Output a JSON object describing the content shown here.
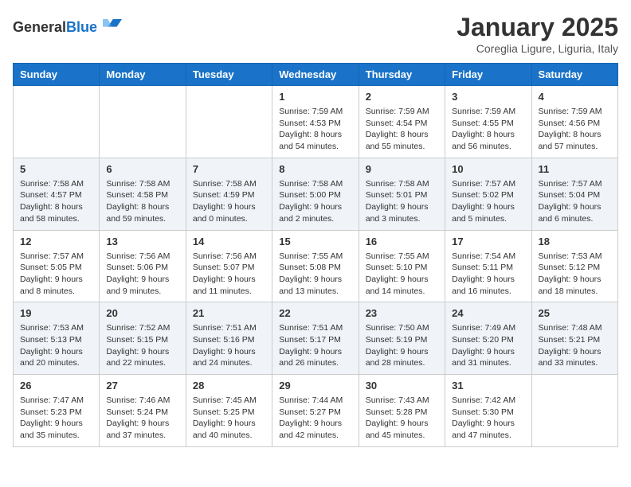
{
  "header": {
    "logo_general": "General",
    "logo_blue": "Blue",
    "month_title": "January 2025",
    "location": "Coreglia Ligure, Liguria, Italy"
  },
  "weekdays": [
    "Sunday",
    "Monday",
    "Tuesday",
    "Wednesday",
    "Thursday",
    "Friday",
    "Saturday"
  ],
  "weeks": [
    [
      {
        "day": "",
        "sunrise": "",
        "sunset": "",
        "daylight": ""
      },
      {
        "day": "",
        "sunrise": "",
        "sunset": "",
        "daylight": ""
      },
      {
        "day": "",
        "sunrise": "",
        "sunset": "",
        "daylight": ""
      },
      {
        "day": "1",
        "sunrise": "Sunrise: 7:59 AM",
        "sunset": "Sunset: 4:53 PM",
        "daylight": "Daylight: 8 hours and 54 minutes."
      },
      {
        "day": "2",
        "sunrise": "Sunrise: 7:59 AM",
        "sunset": "Sunset: 4:54 PM",
        "daylight": "Daylight: 8 hours and 55 minutes."
      },
      {
        "day": "3",
        "sunrise": "Sunrise: 7:59 AM",
        "sunset": "Sunset: 4:55 PM",
        "daylight": "Daylight: 8 hours and 56 minutes."
      },
      {
        "day": "4",
        "sunrise": "Sunrise: 7:59 AM",
        "sunset": "Sunset: 4:56 PM",
        "daylight": "Daylight: 8 hours and 57 minutes."
      }
    ],
    [
      {
        "day": "5",
        "sunrise": "Sunrise: 7:58 AM",
        "sunset": "Sunset: 4:57 PM",
        "daylight": "Daylight: 8 hours and 58 minutes."
      },
      {
        "day": "6",
        "sunrise": "Sunrise: 7:58 AM",
        "sunset": "Sunset: 4:58 PM",
        "daylight": "Daylight: 8 hours and 59 minutes."
      },
      {
        "day": "7",
        "sunrise": "Sunrise: 7:58 AM",
        "sunset": "Sunset: 4:59 PM",
        "daylight": "Daylight: 9 hours and 0 minutes."
      },
      {
        "day": "8",
        "sunrise": "Sunrise: 7:58 AM",
        "sunset": "Sunset: 5:00 PM",
        "daylight": "Daylight: 9 hours and 2 minutes."
      },
      {
        "day": "9",
        "sunrise": "Sunrise: 7:58 AM",
        "sunset": "Sunset: 5:01 PM",
        "daylight": "Daylight: 9 hours and 3 minutes."
      },
      {
        "day": "10",
        "sunrise": "Sunrise: 7:57 AM",
        "sunset": "Sunset: 5:02 PM",
        "daylight": "Daylight: 9 hours and 5 minutes."
      },
      {
        "day": "11",
        "sunrise": "Sunrise: 7:57 AM",
        "sunset": "Sunset: 5:04 PM",
        "daylight": "Daylight: 9 hours and 6 minutes."
      }
    ],
    [
      {
        "day": "12",
        "sunrise": "Sunrise: 7:57 AM",
        "sunset": "Sunset: 5:05 PM",
        "daylight": "Daylight: 9 hours and 8 minutes."
      },
      {
        "day": "13",
        "sunrise": "Sunrise: 7:56 AM",
        "sunset": "Sunset: 5:06 PM",
        "daylight": "Daylight: 9 hours and 9 minutes."
      },
      {
        "day": "14",
        "sunrise": "Sunrise: 7:56 AM",
        "sunset": "Sunset: 5:07 PM",
        "daylight": "Daylight: 9 hours and 11 minutes."
      },
      {
        "day": "15",
        "sunrise": "Sunrise: 7:55 AM",
        "sunset": "Sunset: 5:08 PM",
        "daylight": "Daylight: 9 hours and 13 minutes."
      },
      {
        "day": "16",
        "sunrise": "Sunrise: 7:55 AM",
        "sunset": "Sunset: 5:10 PM",
        "daylight": "Daylight: 9 hours and 14 minutes."
      },
      {
        "day": "17",
        "sunrise": "Sunrise: 7:54 AM",
        "sunset": "Sunset: 5:11 PM",
        "daylight": "Daylight: 9 hours and 16 minutes."
      },
      {
        "day": "18",
        "sunrise": "Sunrise: 7:53 AM",
        "sunset": "Sunset: 5:12 PM",
        "daylight": "Daylight: 9 hours and 18 minutes."
      }
    ],
    [
      {
        "day": "19",
        "sunrise": "Sunrise: 7:53 AM",
        "sunset": "Sunset: 5:13 PM",
        "daylight": "Daylight: 9 hours and 20 minutes."
      },
      {
        "day": "20",
        "sunrise": "Sunrise: 7:52 AM",
        "sunset": "Sunset: 5:15 PM",
        "daylight": "Daylight: 9 hours and 22 minutes."
      },
      {
        "day": "21",
        "sunrise": "Sunrise: 7:51 AM",
        "sunset": "Sunset: 5:16 PM",
        "daylight": "Daylight: 9 hours and 24 minutes."
      },
      {
        "day": "22",
        "sunrise": "Sunrise: 7:51 AM",
        "sunset": "Sunset: 5:17 PM",
        "daylight": "Daylight: 9 hours and 26 minutes."
      },
      {
        "day": "23",
        "sunrise": "Sunrise: 7:50 AM",
        "sunset": "Sunset: 5:19 PM",
        "daylight": "Daylight: 9 hours and 28 minutes."
      },
      {
        "day": "24",
        "sunrise": "Sunrise: 7:49 AM",
        "sunset": "Sunset: 5:20 PM",
        "daylight": "Daylight: 9 hours and 31 minutes."
      },
      {
        "day": "25",
        "sunrise": "Sunrise: 7:48 AM",
        "sunset": "Sunset: 5:21 PM",
        "daylight": "Daylight: 9 hours and 33 minutes."
      }
    ],
    [
      {
        "day": "26",
        "sunrise": "Sunrise: 7:47 AM",
        "sunset": "Sunset: 5:23 PM",
        "daylight": "Daylight: 9 hours and 35 minutes."
      },
      {
        "day": "27",
        "sunrise": "Sunrise: 7:46 AM",
        "sunset": "Sunset: 5:24 PM",
        "daylight": "Daylight: 9 hours and 37 minutes."
      },
      {
        "day": "28",
        "sunrise": "Sunrise: 7:45 AM",
        "sunset": "Sunset: 5:25 PM",
        "daylight": "Daylight: 9 hours and 40 minutes."
      },
      {
        "day": "29",
        "sunrise": "Sunrise: 7:44 AM",
        "sunset": "Sunset: 5:27 PM",
        "daylight": "Daylight: 9 hours and 42 minutes."
      },
      {
        "day": "30",
        "sunrise": "Sunrise: 7:43 AM",
        "sunset": "Sunset: 5:28 PM",
        "daylight": "Daylight: 9 hours and 45 minutes."
      },
      {
        "day": "31",
        "sunrise": "Sunrise: 7:42 AM",
        "sunset": "Sunset: 5:30 PM",
        "daylight": "Daylight: 9 hours and 47 minutes."
      },
      {
        "day": "",
        "sunrise": "",
        "sunset": "",
        "daylight": ""
      }
    ]
  ]
}
